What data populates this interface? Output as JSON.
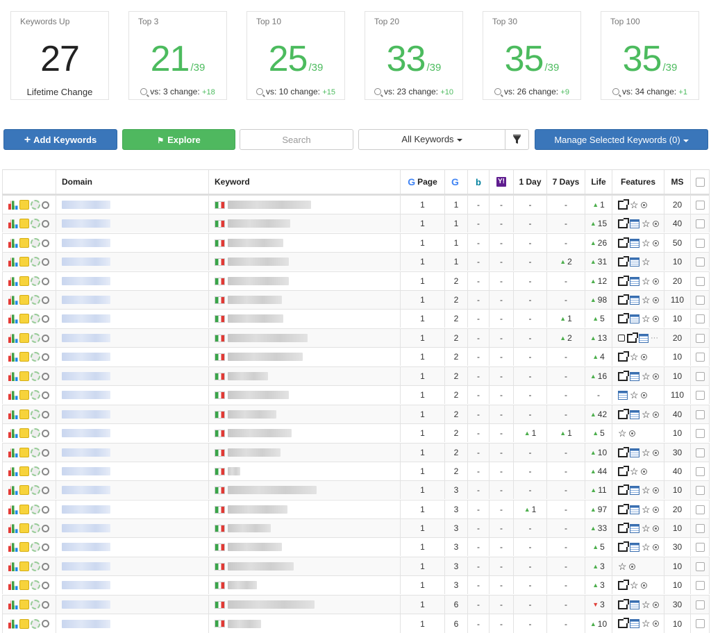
{
  "stats": [
    {
      "label": "Keywords Up",
      "value": "27",
      "denominator": "",
      "subtitle": "Lifetime Change",
      "vs": "",
      "change_label": "",
      "change": ""
    },
    {
      "label": "Top 3",
      "value": "21",
      "denominator": "/39",
      "subtitle": "",
      "vs": "vs: 3",
      "change_label": "change:",
      "change": "+18"
    },
    {
      "label": "Top 10",
      "value": "25",
      "denominator": "/39",
      "subtitle": "",
      "vs": "vs: 10",
      "change_label": "change:",
      "change": "+15"
    },
    {
      "label": "Top 20",
      "value": "33",
      "denominator": "/39",
      "subtitle": "",
      "vs": "vs: 23",
      "change_label": "change:",
      "change": "+10"
    },
    {
      "label": "Top 30",
      "value": "35",
      "denominator": "/39",
      "subtitle": "",
      "vs": "vs: 26",
      "change_label": "change:",
      "change": "+9"
    },
    {
      "label": "Top 100",
      "value": "35",
      "denominator": "/39",
      "subtitle": "",
      "vs": "vs: 34",
      "change_label": "change:",
      "change": "+1"
    }
  ],
  "toolbar": {
    "add_keywords": "Add Keywords",
    "explore": "Explore",
    "search_placeholder": "Search",
    "keyword_filter": "All Keywords",
    "manage_selected": "Manage Selected Keywords (0)"
  },
  "colors": {
    "accent_green": "#4cbb5e",
    "primary_blue": "#3a76ba",
    "up_arrow": "#4cae4c",
    "down_arrow": "#e0403a"
  },
  "table": {
    "headers": {
      "domain": "Domain",
      "keyword": "Keyword",
      "page": "Page",
      "google": "G",
      "bing": "b",
      "yahoo": "Y!",
      "one_day": "1 Day",
      "seven_days": "7 Days",
      "life": "Life",
      "features": "Features",
      "ms": "MS"
    },
    "rows": [
      {
        "page": "1",
        "google": "1",
        "bing": "-",
        "yahoo": "-",
        "day1": "-",
        "day7": "-",
        "life": "1",
        "life_dir": "up",
        "features": [
          "img",
          "star",
          "dot"
        ],
        "ms": "20",
        "kw_w": 120
      },
      {
        "page": "1",
        "google": "1",
        "bing": "-",
        "yahoo": "-",
        "day1": "-",
        "day7": "-",
        "life": "15",
        "life_dir": "up",
        "features": [
          "img",
          "cal",
          "star",
          "dot"
        ],
        "ms": "40",
        "kw_w": 90
      },
      {
        "page": "1",
        "google": "1",
        "bing": "-",
        "yahoo": "-",
        "day1": "-",
        "day7": "-",
        "life": "26",
        "life_dir": "up",
        "features": [
          "img",
          "cal",
          "star",
          "dot"
        ],
        "ms": "50",
        "kw_w": 80
      },
      {
        "page": "1",
        "google": "1",
        "bing": "-",
        "yahoo": "-",
        "day1": "-",
        "day7": "2",
        "day7_dir": "up",
        "life": "31",
        "life_dir": "up",
        "features": [
          "img",
          "cal",
          "star"
        ],
        "ms": "10",
        "kw_w": 88
      },
      {
        "page": "1",
        "google": "2",
        "bing": "-",
        "yahoo": "-",
        "day1": "-",
        "day7": "-",
        "life": "12",
        "life_dir": "up",
        "features": [
          "img",
          "cal",
          "star",
          "dot"
        ],
        "ms": "20",
        "kw_w": 88
      },
      {
        "page": "1",
        "google": "2",
        "bing": "-",
        "yahoo": "-",
        "day1": "-",
        "day7": "-",
        "life": "98",
        "life_dir": "up",
        "features": [
          "img",
          "cal",
          "star",
          "dot"
        ],
        "ms": "110",
        "kw_w": 78
      },
      {
        "page": "1",
        "google": "2",
        "bing": "-",
        "yahoo": "-",
        "day1": "-",
        "day7": "1",
        "day7_dir": "up",
        "life": "5",
        "life_dir": "up",
        "features": [
          "img",
          "cal",
          "star",
          "dot"
        ],
        "ms": "10",
        "kw_w": 80
      },
      {
        "page": "1",
        "google": "2",
        "bing": "-",
        "yahoo": "-",
        "day1": "-",
        "day7": "2",
        "day7_dir": "up",
        "life": "13",
        "life_dir": "up",
        "features": [
          "small",
          "img",
          "cal",
          "more"
        ],
        "ms": "20",
        "kw_w": 115
      },
      {
        "page": "1",
        "google": "2",
        "bing": "-",
        "yahoo": "-",
        "day1": "-",
        "day7": "-",
        "life": "4",
        "life_dir": "up",
        "features": [
          "img",
          "star",
          "dot"
        ],
        "ms": "10",
        "kw_w": 108
      },
      {
        "page": "1",
        "google": "2",
        "bing": "-",
        "yahoo": "-",
        "day1": "-",
        "day7": "-",
        "life": "16",
        "life_dir": "up",
        "features": [
          "img",
          "cal",
          "star",
          "dot"
        ],
        "ms": "10",
        "kw_w": 58
      },
      {
        "page": "1",
        "google": "2",
        "bing": "-",
        "yahoo": "-",
        "day1": "-",
        "day7": "-",
        "life": "-",
        "life_dir": "",
        "features": [
          "cal",
          "star",
          "dot"
        ],
        "ms": "110",
        "kw_w": 88
      },
      {
        "page": "1",
        "google": "2",
        "bing": "-",
        "yahoo": "-",
        "day1": "-",
        "day7": "-",
        "life": "42",
        "life_dir": "up",
        "features": [
          "img",
          "cal",
          "star",
          "dot"
        ],
        "ms": "40",
        "kw_w": 70
      },
      {
        "page": "1",
        "google": "2",
        "bing": "-",
        "yahoo": "-",
        "day1": "1",
        "day1_dir": "up",
        "day7": "1",
        "day7_dir": "up",
        "life": "5",
        "life_dir": "up",
        "features": [
          "star",
          "dot"
        ],
        "ms": "10",
        "kw_w": 92
      },
      {
        "page": "1",
        "google": "2",
        "bing": "-",
        "yahoo": "-",
        "day1": "-",
        "day7": "-",
        "life": "10",
        "life_dir": "up",
        "features": [
          "img",
          "cal",
          "star",
          "dot"
        ],
        "ms": "30",
        "kw_w": 76
      },
      {
        "page": "1",
        "google": "2",
        "bing": "-",
        "yahoo": "-",
        "day1": "-",
        "day7": "-",
        "life": "44",
        "life_dir": "up",
        "features": [
          "img",
          "star",
          "dot"
        ],
        "ms": "40",
        "kw_w": 18
      },
      {
        "page": "1",
        "google": "3",
        "bing": "-",
        "yahoo": "-",
        "day1": "-",
        "day7": "-",
        "life": "11",
        "life_dir": "up",
        "features": [
          "img",
          "cal",
          "star",
          "dot"
        ],
        "ms": "10",
        "kw_w": 128
      },
      {
        "page": "1",
        "google": "3",
        "bing": "-",
        "yahoo": "-",
        "day1": "1",
        "day1_dir": "up",
        "day7": "-",
        "life": "97",
        "life_dir": "up",
        "features": [
          "img",
          "cal",
          "star",
          "dot"
        ],
        "ms": "20",
        "kw_w": 86
      },
      {
        "page": "1",
        "google": "3",
        "bing": "-",
        "yahoo": "-",
        "day1": "-",
        "day7": "-",
        "life": "33",
        "life_dir": "up",
        "features": [
          "img",
          "cal",
          "star",
          "dot"
        ],
        "ms": "10",
        "kw_w": 62
      },
      {
        "page": "1",
        "google": "3",
        "bing": "-",
        "yahoo": "-",
        "day1": "-",
        "day7": "-",
        "life": "5",
        "life_dir": "up",
        "features": [
          "img",
          "cal",
          "star",
          "dot"
        ],
        "ms": "30",
        "kw_w": 78
      },
      {
        "page": "1",
        "google": "3",
        "bing": "-",
        "yahoo": "-",
        "day1": "-",
        "day7": "-",
        "life": "3",
        "life_dir": "up",
        "features": [
          "star",
          "dot"
        ],
        "ms": "10",
        "kw_w": 95
      },
      {
        "page": "1",
        "google": "3",
        "bing": "-",
        "yahoo": "-",
        "day1": "-",
        "day7": "-",
        "life": "3",
        "life_dir": "up",
        "features": [
          "img",
          "star",
          "dot"
        ],
        "ms": "10",
        "kw_w": 42
      },
      {
        "page": "1",
        "google": "6",
        "bing": "-",
        "yahoo": "-",
        "day1": "-",
        "day7": "-",
        "life": "3",
        "life_dir": "down",
        "features": [
          "img",
          "cal",
          "star",
          "dot"
        ],
        "ms": "30",
        "kw_w": 125
      },
      {
        "page": "1",
        "google": "6",
        "bing": "-",
        "yahoo": "-",
        "day1": "-",
        "day7": "-",
        "life": "10",
        "life_dir": "up",
        "features": [
          "img",
          "cal",
          "star",
          "dot"
        ],
        "ms": "10",
        "kw_w": 48
      }
    ]
  }
}
